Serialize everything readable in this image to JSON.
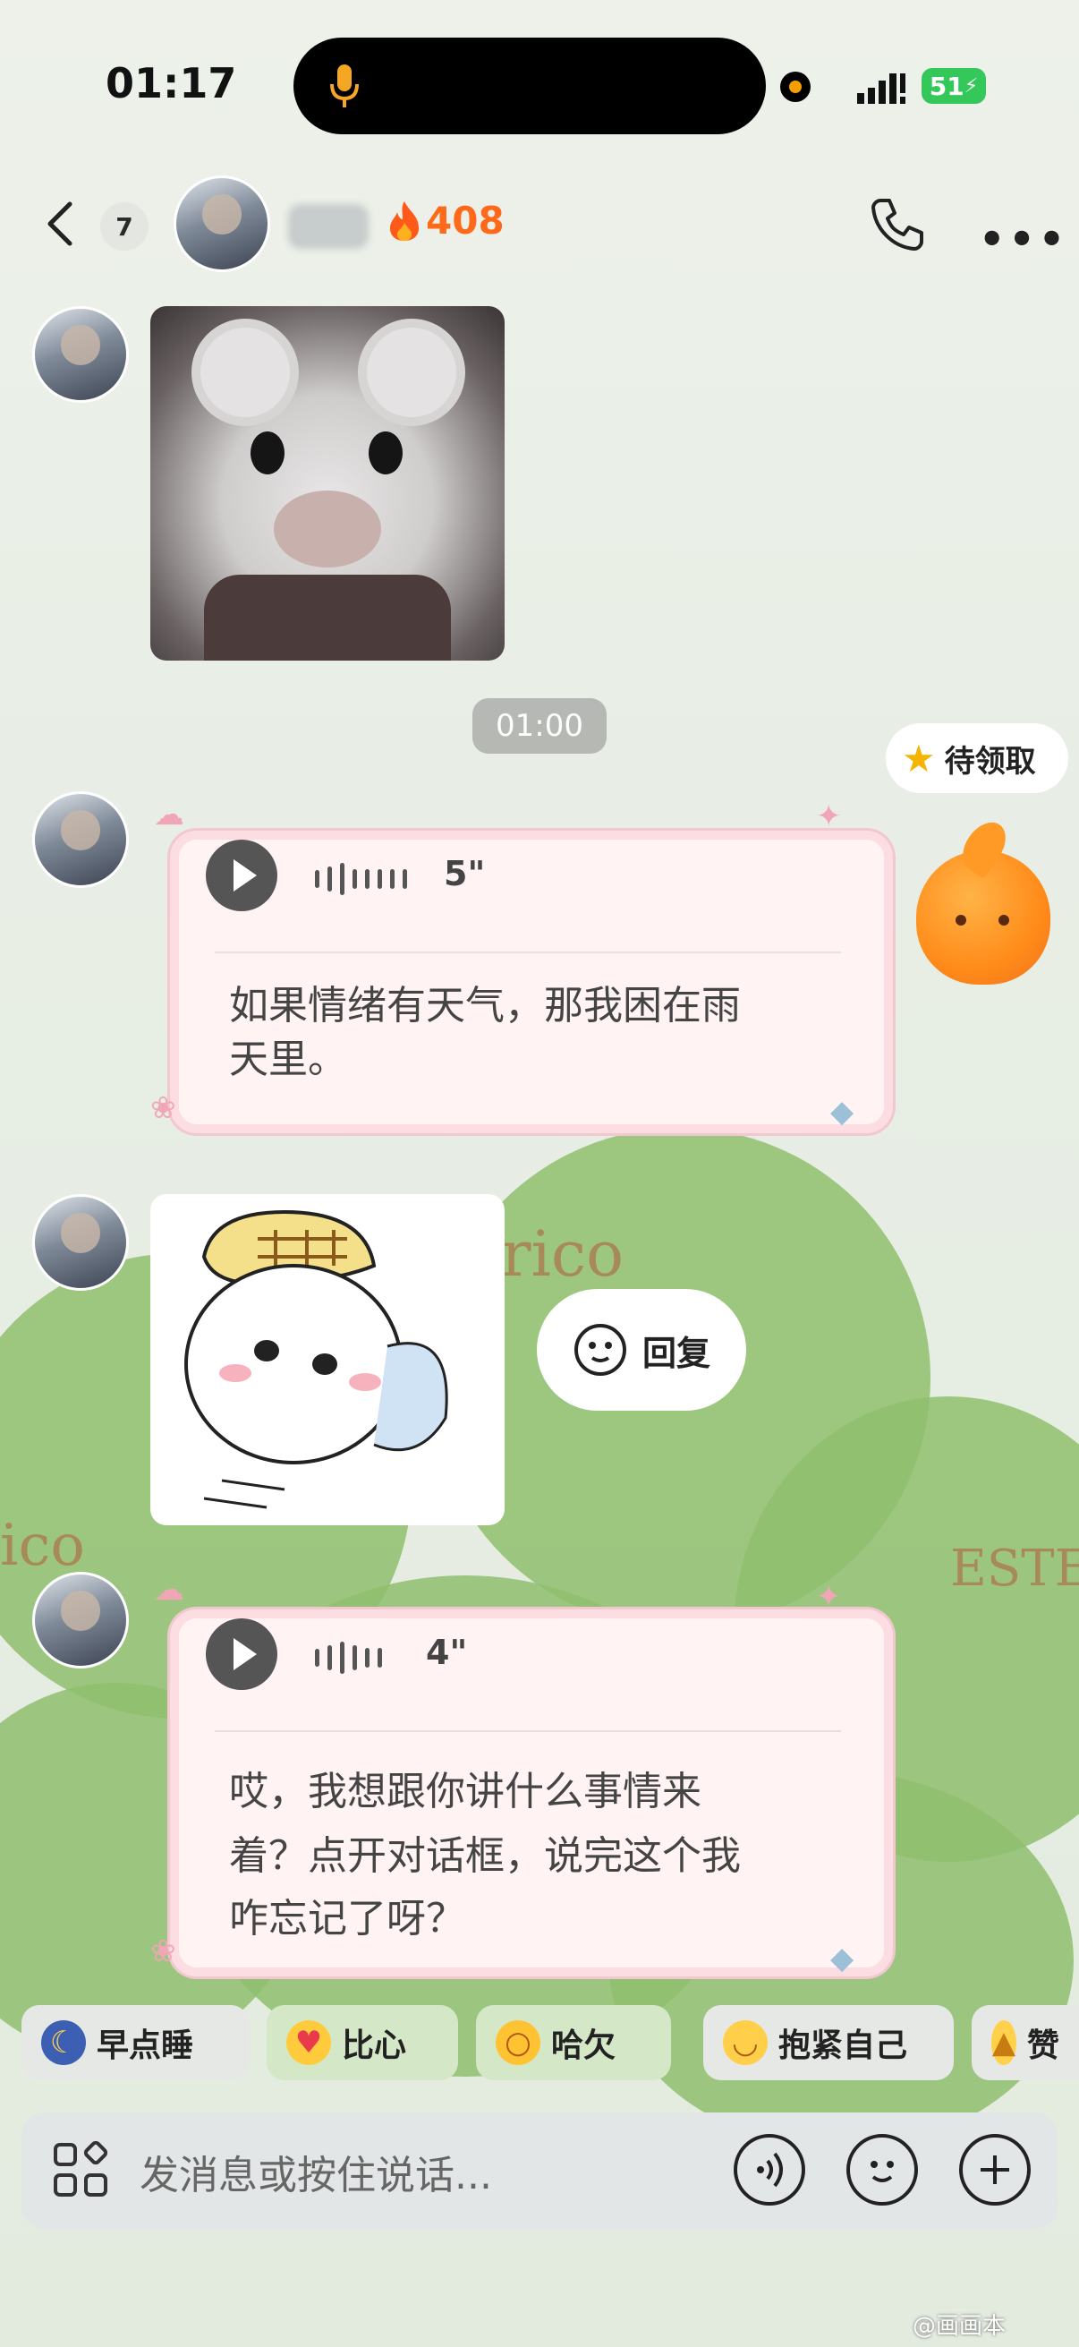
{
  "status_bar": {
    "time": "01:17",
    "battery": "51"
  },
  "header": {
    "unread_count": "7",
    "streak_count": "408"
  },
  "messages": {
    "timestamp": "01:00",
    "voice1": {
      "duration": "5\"",
      "transcript_line1": "如果情绪有天气，那我困在雨",
      "transcript_line2": "天里。"
    },
    "voice2": {
      "duration": "4\"",
      "transcript_line1": "哎，我想跟你讲什么事情来",
      "transcript_line2": "着？点开对话框，说完这个我",
      "transcript_line3": "咋忘记了呀？"
    },
    "reply_label": "回复"
  },
  "reward": {
    "label": "待领取"
  },
  "background_text": {
    "word1": "rico",
    "word2": "ico",
    "word3": "ESTE"
  },
  "quick_replies": [
    {
      "label": "早点睡",
      "icon": "moon-emoji-icon"
    },
    {
      "label": "比心",
      "icon": "heart-hands-emoji-icon"
    },
    {
      "label": "哈欠",
      "icon": "yawn-emoji-icon"
    },
    {
      "label": "抱紧自己",
      "icon": "self-hug-emoji-icon"
    },
    {
      "label": "赞",
      "icon": "thumbs-up-icon"
    }
  ],
  "input": {
    "placeholder": "发消息或按住说话..."
  },
  "watermark": "@画画本",
  "colors": {
    "accent_orange": "#ff6a1a",
    "card_bg": "#fff3f3",
    "card_border": "#fbdde2",
    "chip_green": "#d4e8c8",
    "chip_gray": "#e6e8e6"
  }
}
